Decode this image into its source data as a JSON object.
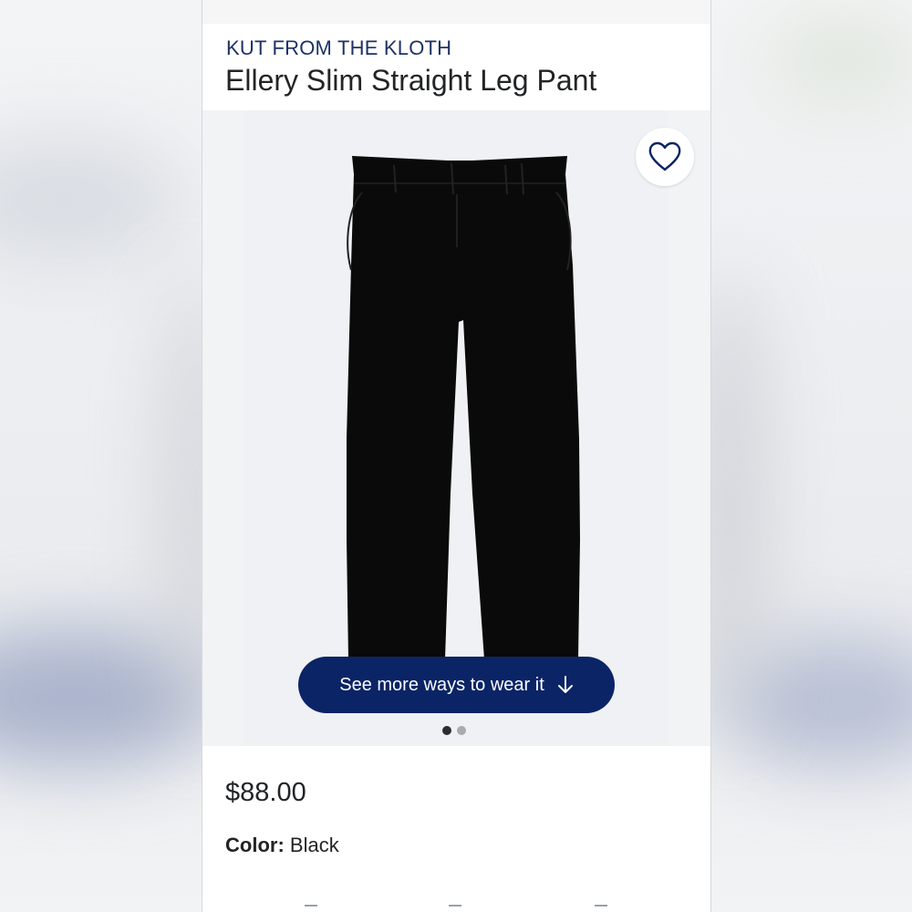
{
  "product": {
    "brand": "KUT FROM THE KLOTH",
    "name": "Ellery Slim Straight Leg Pant",
    "price": "$88.00",
    "color_label": "Color:",
    "color_value": "Black"
  },
  "gallery": {
    "wear_button_label": "See more ways to wear it",
    "favorite_icon": "heart-icon",
    "arrow_icon": "arrow-down-icon",
    "total_images": 2,
    "active_image": 1
  },
  "colors": {
    "brand_text": "#1e3266",
    "button_bg": "#0b2466",
    "product": "#0a0a0a"
  }
}
